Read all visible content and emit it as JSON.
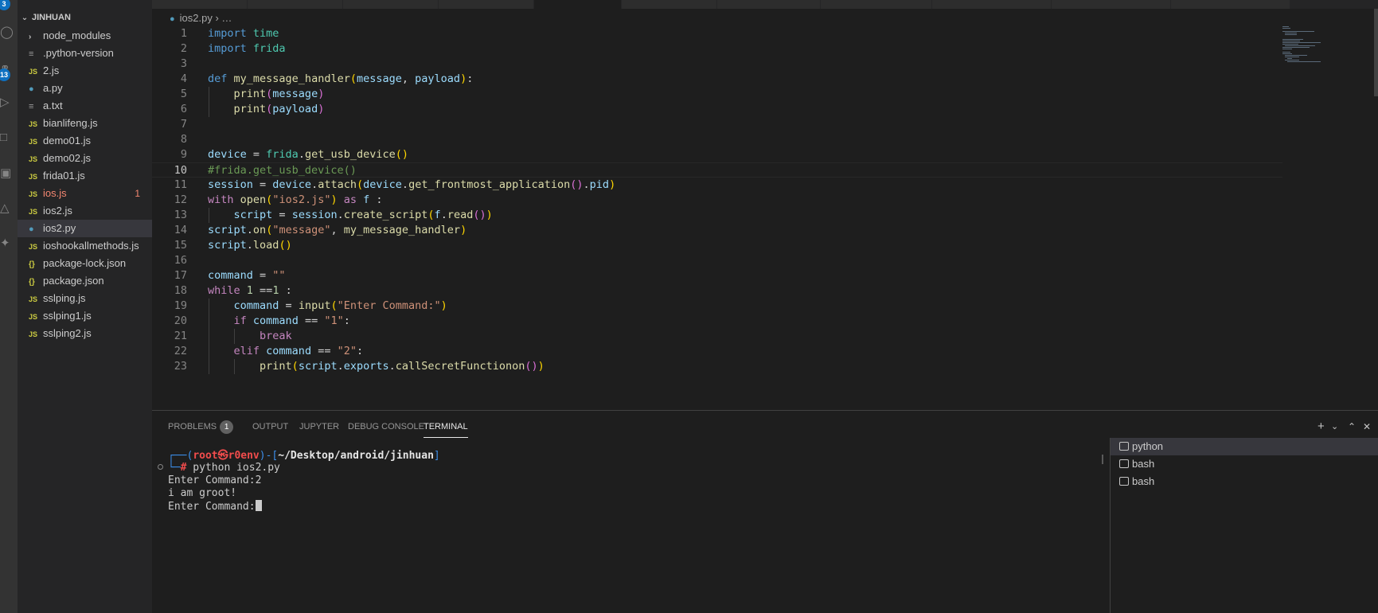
{
  "activity_bar": {
    "scm_badge": "3",
    "extensions_badge": "13"
  },
  "explorer": {
    "folder_name": "JINHUAN",
    "files": [
      {
        "name": "node_modules",
        "kind": "folder"
      },
      {
        "name": ".python-version",
        "kind": "txt"
      },
      {
        "name": "2.js",
        "kind": "js"
      },
      {
        "name": "a.py",
        "kind": "py"
      },
      {
        "name": "a.txt",
        "kind": "txt"
      },
      {
        "name": "bianlifeng.js",
        "kind": "js"
      },
      {
        "name": "demo01.js",
        "kind": "js"
      },
      {
        "name": "demo02.js",
        "kind": "js"
      },
      {
        "name": "frida01.js",
        "kind": "js"
      },
      {
        "name": "ios.js",
        "kind": "js",
        "problems": "1"
      },
      {
        "name": "ios2.js",
        "kind": "js"
      },
      {
        "name": "ios2.py",
        "kind": "py",
        "active": true
      },
      {
        "name": "ioshookallmethods.js",
        "kind": "js"
      },
      {
        "name": "package-lock.json",
        "kind": "json"
      },
      {
        "name": "package.json",
        "kind": "json"
      },
      {
        "name": "sslping.js",
        "kind": "js"
      },
      {
        "name": "sslping1.js",
        "kind": "js"
      },
      {
        "name": "sslping2.js",
        "kind": "js"
      }
    ],
    "icons": {
      "js": "JS",
      "json": "{}",
      "py": "●",
      "txt": "≡",
      "folder": "›"
    }
  },
  "editor": {
    "breadcrumb_file": "ios2.py",
    "breadcrumb_rest": "› …",
    "current_line": 10,
    "lines": [
      [
        [
          "k",
          "import"
        ],
        [
          "t",
          " "
        ],
        [
          "m",
          "time"
        ]
      ],
      [
        [
          "k",
          "import"
        ],
        [
          "t",
          " "
        ],
        [
          "m",
          "frida"
        ]
      ],
      [],
      [
        [
          "k",
          "def"
        ],
        [
          "t",
          " "
        ],
        [
          "f",
          "my_message_handler"
        ],
        [
          "b1",
          "("
        ],
        [
          "v",
          "message"
        ],
        [
          "t",
          ", "
        ],
        [
          "v",
          "payload"
        ],
        [
          "b1",
          ")"
        ],
        [
          "t",
          ":"
        ]
      ],
      [
        [
          "t",
          "    "
        ],
        [
          "f",
          "print"
        ],
        [
          "b2",
          "("
        ],
        [
          "v",
          "message"
        ],
        [
          "b2",
          ")"
        ]
      ],
      [
        [
          "t",
          "    "
        ],
        [
          "f",
          "print"
        ],
        [
          "b2",
          "("
        ],
        [
          "v",
          "payload"
        ],
        [
          "b2",
          ")"
        ]
      ],
      [],
      [],
      [
        [
          "v",
          "device"
        ],
        [
          "t",
          " = "
        ],
        [
          "m",
          "frida"
        ],
        [
          "t",
          "."
        ],
        [
          "f",
          "get_usb_device"
        ],
        [
          "b1",
          "()"
        ]
      ],
      [
        [
          "c",
          "#frida.get_usb_device()"
        ]
      ],
      [
        [
          "v",
          "session"
        ],
        [
          "t",
          " = "
        ],
        [
          "v",
          "device"
        ],
        [
          "t",
          "."
        ],
        [
          "f",
          "attach"
        ],
        [
          "b1",
          "("
        ],
        [
          "v",
          "device"
        ],
        [
          "t",
          "."
        ],
        [
          "f",
          "get_frontmost_application"
        ],
        [
          "b2",
          "()"
        ],
        [
          "t",
          "."
        ],
        [
          "v",
          "pid"
        ],
        [
          "b1",
          ")"
        ]
      ],
      [
        [
          "kc",
          "with"
        ],
        [
          "t",
          " "
        ],
        [
          "f",
          "open"
        ],
        [
          "b1",
          "("
        ],
        [
          "s",
          "\"ios2.js\""
        ],
        [
          "b1",
          ")"
        ],
        [
          "t",
          " "
        ],
        [
          "kc",
          "as"
        ],
        [
          "t",
          " "
        ],
        [
          "v",
          "f"
        ],
        [
          "t",
          " :"
        ]
      ],
      [
        [
          "t",
          "    "
        ],
        [
          "v",
          "script"
        ],
        [
          "t",
          " = "
        ],
        [
          "v",
          "session"
        ],
        [
          "t",
          "."
        ],
        [
          "f",
          "create_script"
        ],
        [
          "b1",
          "("
        ],
        [
          "v",
          "f"
        ],
        [
          "t",
          "."
        ],
        [
          "f",
          "read"
        ],
        [
          "b2",
          "()"
        ],
        [
          "b1",
          ")"
        ]
      ],
      [
        [
          "v",
          "script"
        ],
        [
          "t",
          "."
        ],
        [
          "f",
          "on"
        ],
        [
          "b1",
          "("
        ],
        [
          "s",
          "\"message\""
        ],
        [
          "t",
          ", "
        ],
        [
          "f",
          "my_message_handler"
        ],
        [
          "b1",
          ")"
        ]
      ],
      [
        [
          "v",
          "script"
        ],
        [
          "t",
          "."
        ],
        [
          "f",
          "load"
        ],
        [
          "b1",
          "()"
        ]
      ],
      [],
      [
        [
          "v",
          "command"
        ],
        [
          "t",
          " = "
        ],
        [
          "s",
          "\"\""
        ]
      ],
      [
        [
          "kc",
          "while"
        ],
        [
          "t",
          " "
        ],
        [
          "n",
          "1"
        ],
        [
          "t",
          " =="
        ],
        [
          "n",
          "1"
        ],
        [
          "t",
          " :"
        ]
      ],
      [
        [
          "t",
          "    "
        ],
        [
          "v",
          "command"
        ],
        [
          "t",
          " = "
        ],
        [
          "f",
          "input"
        ],
        [
          "b1",
          "("
        ],
        [
          "s",
          "\"Enter Command:\""
        ],
        [
          "b1",
          ")"
        ]
      ],
      [
        [
          "t",
          "    "
        ],
        [
          "kc",
          "if"
        ],
        [
          "t",
          " "
        ],
        [
          "v",
          "command"
        ],
        [
          "t",
          " == "
        ],
        [
          "s",
          "\"1\""
        ],
        [
          "t",
          ":"
        ]
      ],
      [
        [
          "t",
          "        "
        ],
        [
          "kc",
          "break"
        ]
      ],
      [
        [
          "t",
          "    "
        ],
        [
          "kc",
          "elif"
        ],
        [
          "t",
          " "
        ],
        [
          "v",
          "command"
        ],
        [
          "t",
          " == "
        ],
        [
          "s",
          "\"2\""
        ],
        [
          "t",
          ":"
        ]
      ],
      [
        [
          "t",
          "        "
        ],
        [
          "f",
          "print"
        ],
        [
          "b1",
          "("
        ],
        [
          "v",
          "script"
        ],
        [
          "t",
          "."
        ],
        [
          "v",
          "exports"
        ],
        [
          "t",
          "."
        ],
        [
          "f",
          "callSecretFunctionon"
        ],
        [
          "b2",
          "()"
        ],
        [
          "b1",
          ")"
        ]
      ]
    ]
  },
  "panel": {
    "tabs": [
      {
        "label": "PROBLEMS",
        "badge": "1"
      },
      {
        "label": "OUTPUT"
      },
      {
        "label": "JUPYTER"
      },
      {
        "label": "DEBUG CONSOLE"
      },
      {
        "label": "TERMINAL",
        "active": true
      }
    ],
    "controls": {
      "add": "+",
      "dropdown": "⌄",
      "maximize": "⌃",
      "close": "✕"
    },
    "terminal": {
      "prompt_open": "┌──(",
      "user": "root㉿r0env",
      "prompt_mid": ")-[",
      "cwd": "~/Desktop/android/jinhuan",
      "prompt_close": "]",
      "prompt_line2": "└─",
      "hash": "#",
      "command": " python ios2.py",
      "output": [
        "Enter Command:2",
        "i am groot!",
        "Enter Command:"
      ]
    },
    "terminal_list": [
      "python",
      "bash",
      "bash"
    ]
  }
}
